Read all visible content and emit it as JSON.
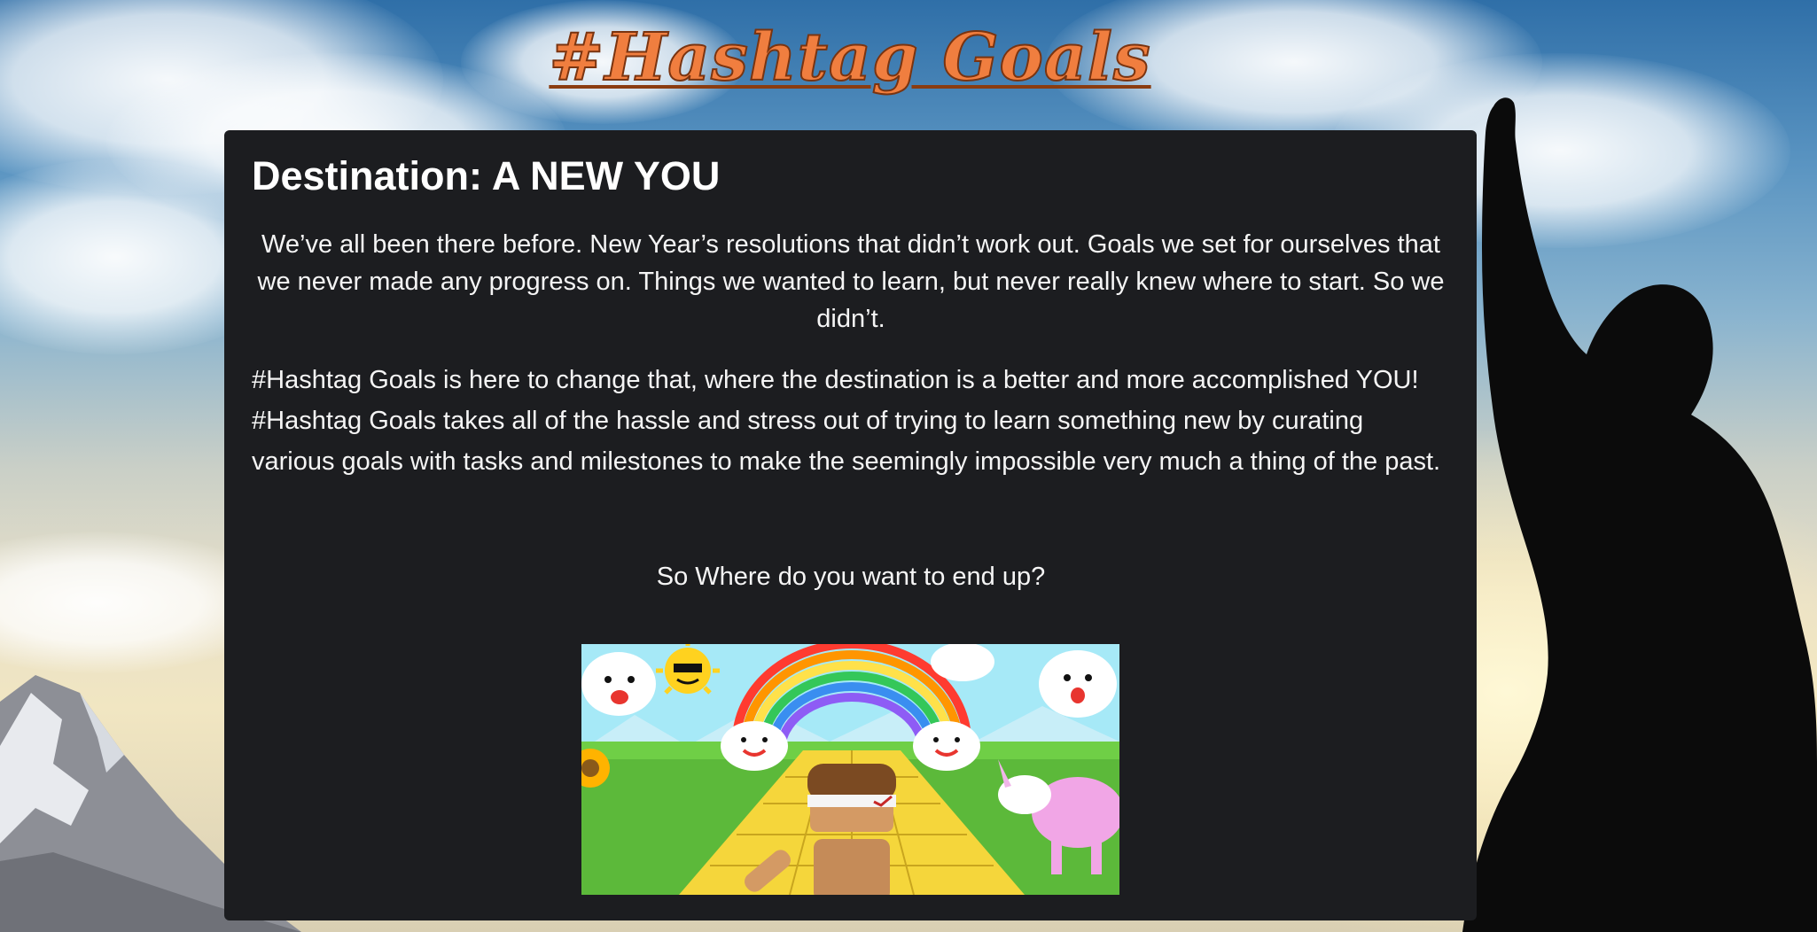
{
  "site": {
    "title": "#Hashtag Goals"
  },
  "card": {
    "heading": "Destination: A NEW YOU",
    "intro": "We’ve all been there before. New Year’s resolutions that didn’t work out. Goals we set for ourselves that we never made any progress on. Things we wanted to learn, but never really knew where to start. So we didn’t.",
    "description": "#Hashtag Goals is here to change that, where the destination is a better and more accomplished YOU! #Hashtag Goals takes all of the hassle and stress out of trying to learn something new by curating various goals with tasks and milestones to make the seemingly impossible very much a thing of the past.",
    "question": "So Where do you want to end up?"
  },
  "illustration": {
    "icon": "pixel-art-runner-rainbow-road"
  },
  "colors": {
    "title": "#f07e3f",
    "card_background": "#1c1d20"
  }
}
